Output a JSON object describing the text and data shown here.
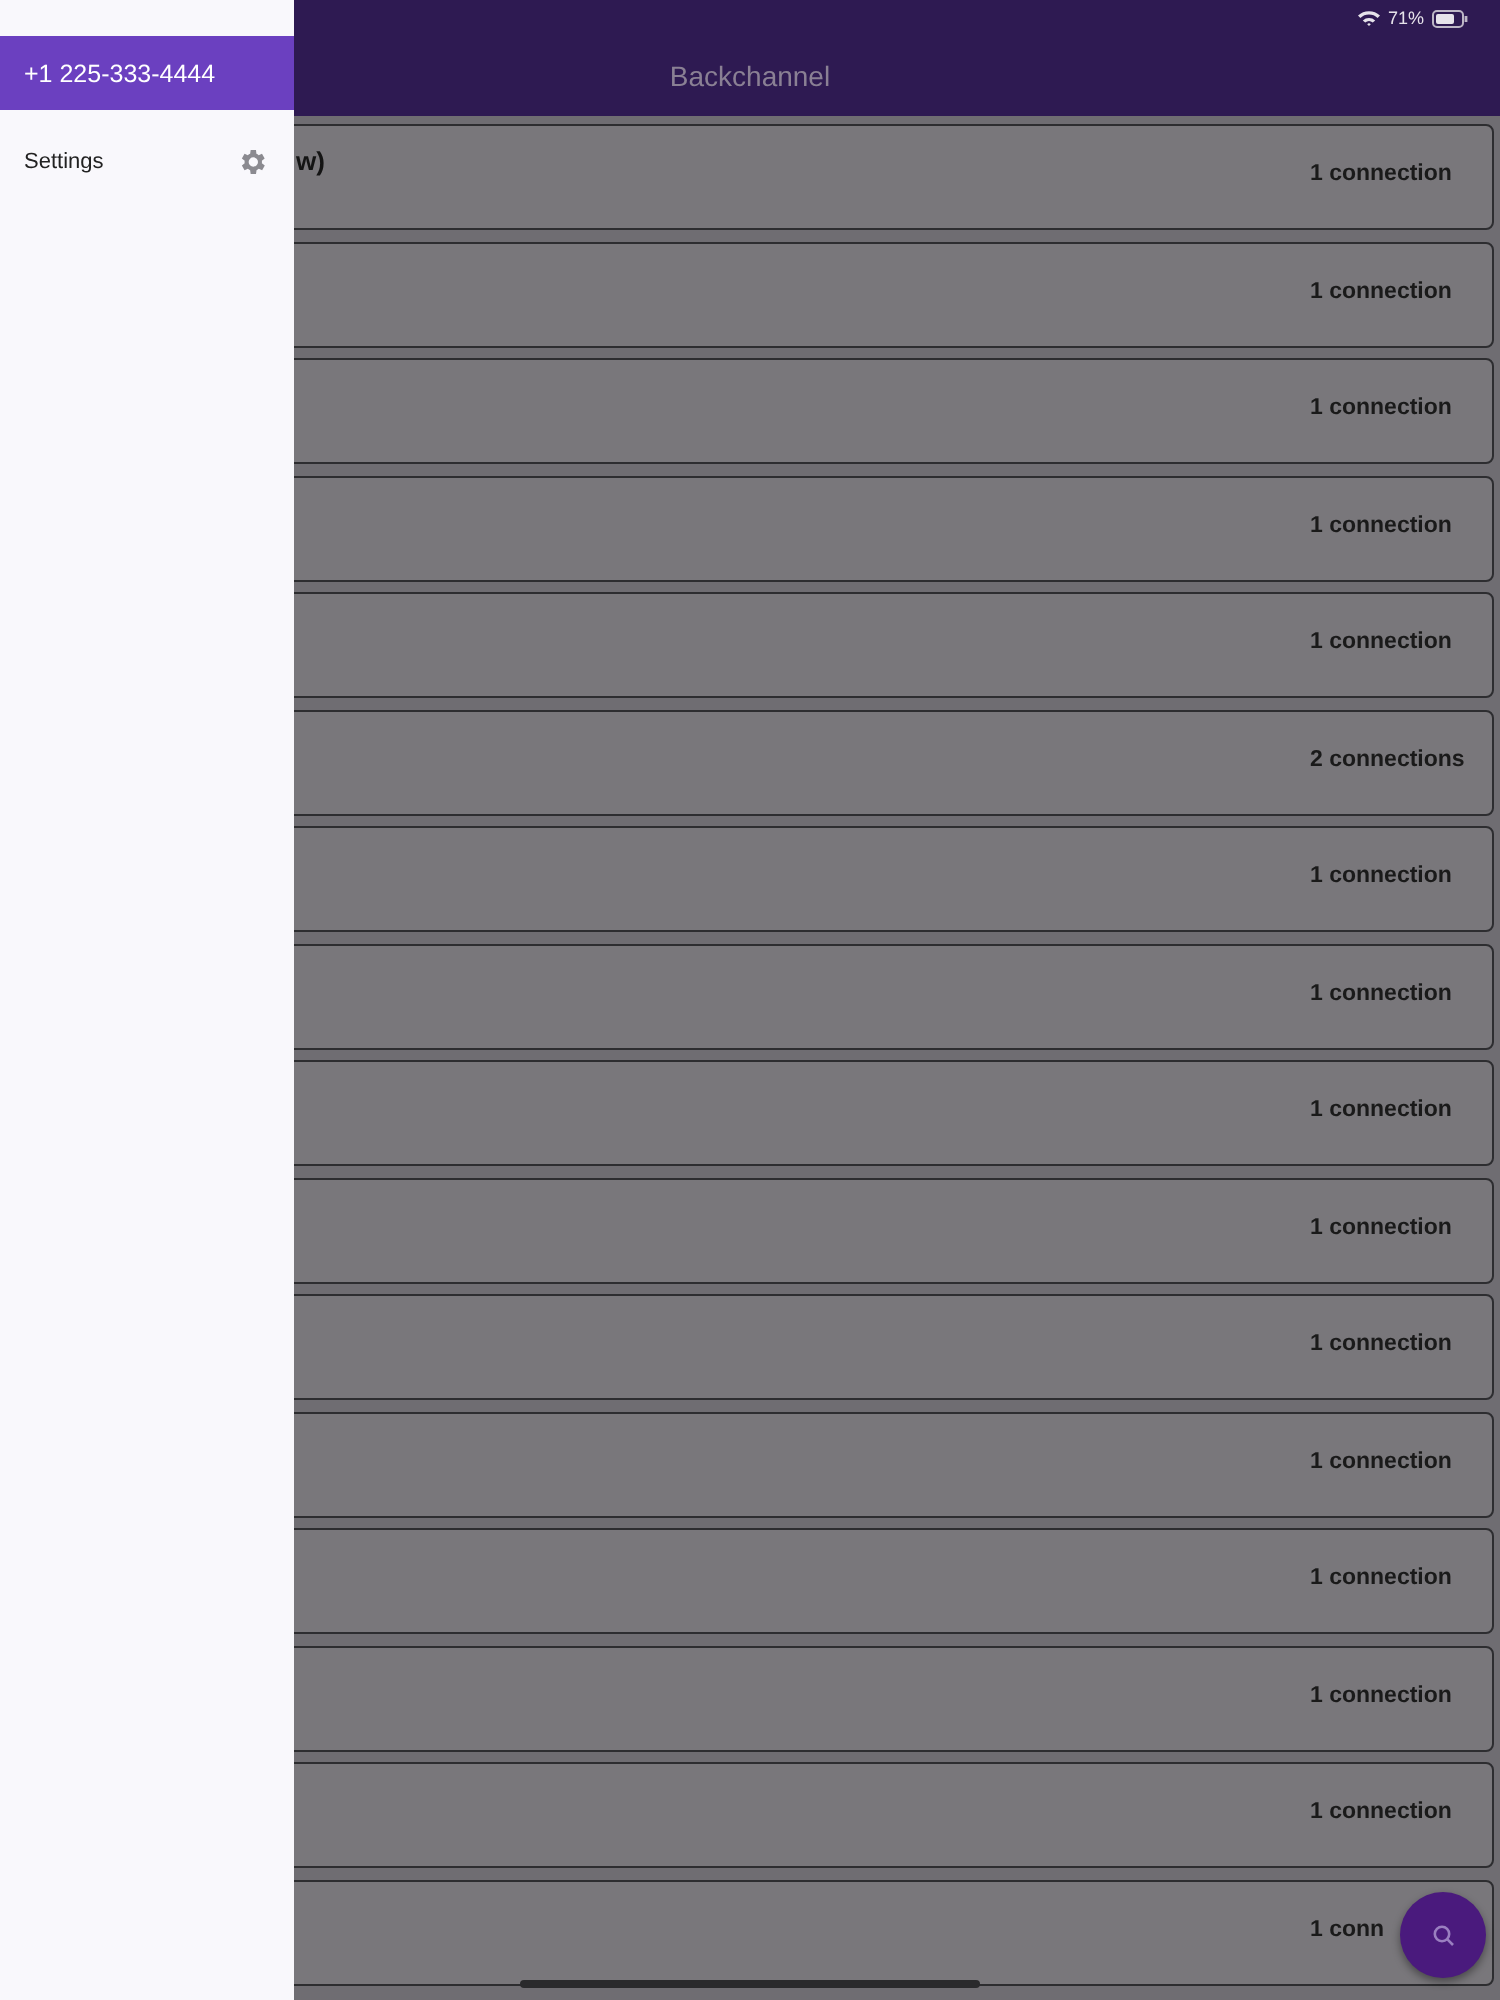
{
  "status_bar": {
    "battery_text": "71%"
  },
  "header": {
    "title": "Backchannel"
  },
  "drawer": {
    "account": "+1 225-333-4444",
    "items": [
      {
        "label": "Settings"
      }
    ]
  },
  "list": [
    {
      "title": "w)",
      "count": "1 connection"
    },
    {
      "count": "1 connection"
    },
    {
      "count": "1 connection"
    },
    {
      "count": "1 connection"
    },
    {
      "count": "1 connection"
    },
    {
      "count": "2 connections"
    },
    {
      "count": "1 connection"
    },
    {
      "count": "1 connection"
    },
    {
      "count": "1 connection"
    },
    {
      "count": "1 connection"
    },
    {
      "count": "1 connection"
    },
    {
      "count": "1 connection"
    },
    {
      "count": "1 connection"
    },
    {
      "count": "1 connection"
    },
    {
      "count": "1 connection"
    },
    {
      "count": "1 conn"
    }
  ]
}
